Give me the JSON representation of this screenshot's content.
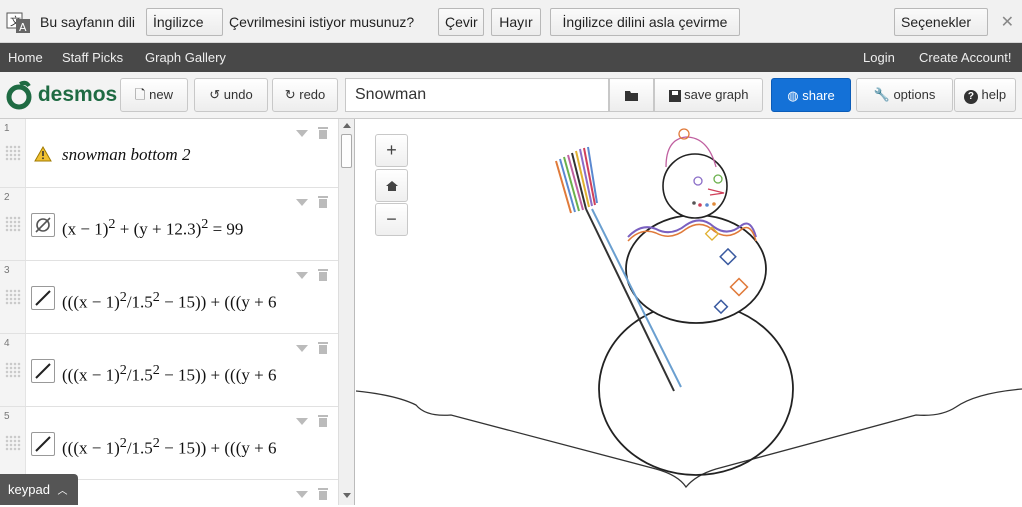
{
  "translate_bar": {
    "prompt_prefix": "Bu sayfanın dili",
    "language": "İngilizce",
    "prompt_suffix": "Çevrilmesini istiyor musunuz?",
    "translate": "Çevir",
    "no": "Hayır",
    "never": "İngilizce dilini asla çevirme",
    "options": "Seçenekler",
    "close": "✕"
  },
  "nav": {
    "home": "Home",
    "staff_picks": "Staff Picks",
    "graph_gallery": "Graph Gallery",
    "login": "Login",
    "create_account": "Create Account!"
  },
  "toolbar": {
    "logo": "desmos",
    "new": "new",
    "undo": "undo",
    "redo": "redo",
    "title": "Snowman",
    "save": "save graph",
    "share": "share",
    "options": "options",
    "help": "help"
  },
  "expressions": [
    {
      "num": "1",
      "text": "snowman bottom 2",
      "kind": "note"
    },
    {
      "num": "2",
      "kind": "equation",
      "parts": [
        "(x − 1)",
        "2",
        " + (y + 12.3)",
        "2",
        " = 99"
      ]
    },
    {
      "num": "3",
      "kind": "equation",
      "parts": [
        "(((x − 1)",
        "2",
        "/1.5",
        "2",
        " − 15)) + (((y + 6"
      ]
    },
    {
      "num": "4",
      "kind": "equation",
      "parts": [
        "(((x − 1)",
        "2",
        "/1.5",
        "2",
        " − 15)) + (((y + 6"
      ]
    },
    {
      "num": "5",
      "kind": "equation",
      "parts": [
        "(((x − 1)",
        "2",
        "/1.5",
        "2",
        " − 15)) + (((y + 6"
      ]
    }
  ],
  "keypad": "keypad",
  "zoom": {
    "in": "+",
    "out": "−"
  },
  "colors": {
    "accent": "#1471d7",
    "logo": "#1f6b43",
    "nav": "#484848"
  }
}
